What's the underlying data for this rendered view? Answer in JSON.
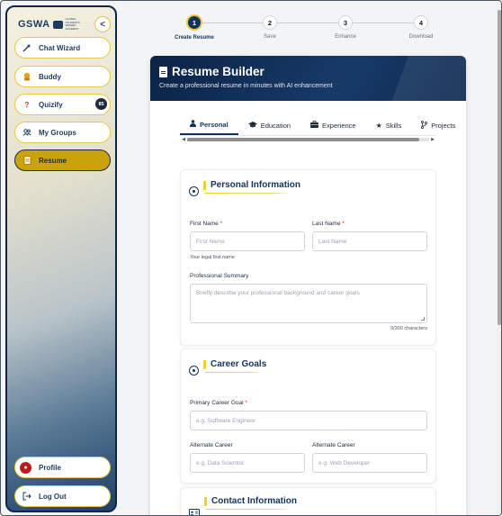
{
  "sidebar": {
    "brand": {
      "logo": "GSWA",
      "tagline": "GLOBAL STUDENTS WIZARD ACADEMY"
    },
    "collapse_label": "<",
    "items": [
      {
        "label": "Chat Wizard",
        "icon": "wand-icon"
      },
      {
        "label": "Buddy",
        "icon": "buddy-icon"
      },
      {
        "label": "Quizify",
        "icon": "question-icon",
        "badge": "85"
      },
      {
        "label": "My Groups",
        "icon": "users-icon"
      },
      {
        "label": "Resume",
        "icon": "resume-icon",
        "active": true
      }
    ],
    "footer": [
      {
        "label": "Profile",
        "icon": "avatar-icon"
      },
      {
        "label": "Log Out",
        "icon": "logout-icon"
      }
    ]
  },
  "stepper": {
    "steps": [
      {
        "num": "1",
        "label": "Create Resume",
        "active": true
      },
      {
        "num": "2",
        "label": "Save"
      },
      {
        "num": "3",
        "label": "Enhance"
      },
      {
        "num": "4",
        "label": "Download"
      }
    ]
  },
  "card": {
    "title": "Resume Builder",
    "subtitle": "Create a professional resume in minutes with AI enhancement"
  },
  "tabs": [
    {
      "label": "Personal",
      "icon": "person-icon",
      "active": true
    },
    {
      "label": "Education",
      "icon": "graduation-cap-icon"
    },
    {
      "label": "Experience",
      "icon": "briefcase-icon"
    },
    {
      "label": "Skills",
      "icon": "star-icon"
    },
    {
      "label": "Projects",
      "icon": "branch-icon"
    }
  ],
  "personal": {
    "title": "Personal Information",
    "first_name_label": "First Name",
    "first_name_placeholder": "First Name",
    "first_name_hint": "Your legal first name",
    "last_name_label": "Last Name",
    "last_name_placeholder": "Last Name",
    "summary_label": "Professional Summary",
    "summary_placeholder": "Briefly describe your professional background and career goals",
    "summary_counter": "0/300 characters",
    "required_mark": "*"
  },
  "career": {
    "title": "Career Goals",
    "primary_label": "Primary Career Goal",
    "primary_placeholder": "e.g. Software Engineer",
    "alt1_label": "Alternate Career",
    "alt1_placeholder": "e.g. Data Scientist",
    "alt2_label": "Alternate Career",
    "alt2_placeholder": "e.g. Web Developer"
  },
  "contact": {
    "title": "Contact Information"
  },
  "colors": {
    "navy": "#13335a",
    "gold": "#c9a20c",
    "accent_yellow": "#f1d02a"
  }
}
